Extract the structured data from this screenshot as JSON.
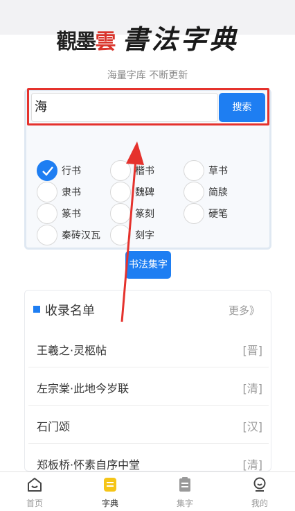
{
  "logo": {
    "seal_left": "觀墨",
    "seal_red": "雲",
    "title": "書法字典"
  },
  "slogan": "海量字库 不断更新",
  "search": {
    "value": "海",
    "button_label": "搜索"
  },
  "styles": [
    {
      "label": "行书",
      "checked": true
    },
    {
      "label": "楷书",
      "checked": false
    },
    {
      "label": "草书",
      "checked": false
    },
    {
      "label": "隶书",
      "checked": false
    },
    {
      "label": "魏碑",
      "checked": false
    },
    {
      "label": "简牍",
      "checked": false
    },
    {
      "label": "篆书",
      "checked": false
    },
    {
      "label": "篆刻",
      "checked": false
    },
    {
      "label": "硬笔",
      "checked": false
    },
    {
      "label": "秦砖汉瓦",
      "checked": false
    },
    {
      "label": "刻字",
      "checked": false
    }
  ],
  "collect_button_label": "书法集字",
  "records": {
    "title": "收录名单",
    "more": "更多》",
    "items": [
      {
        "name": "王羲之·灵柩帖",
        "dynasty": "[晋]"
      },
      {
        "name": "左宗棠·此地今岁联",
        "dynasty": "[清]"
      },
      {
        "name": "石门颂",
        "dynasty": "[汉]"
      },
      {
        "name": "郑板桥·怀素自序中堂",
        "dynasty": "[清]"
      }
    ]
  },
  "tabs": [
    {
      "label": "首页",
      "icon": "home-icon",
      "active": false
    },
    {
      "label": "字典",
      "icon": "dictionary-icon",
      "active": true
    },
    {
      "label": "集字",
      "icon": "clipboard-icon",
      "active": false
    },
    {
      "label": "我的",
      "icon": "profile-icon",
      "active": false
    }
  ],
  "colors": {
    "accent": "#1e7ef2",
    "highlight": "#e5322d",
    "active_tab": "#f5c518"
  }
}
